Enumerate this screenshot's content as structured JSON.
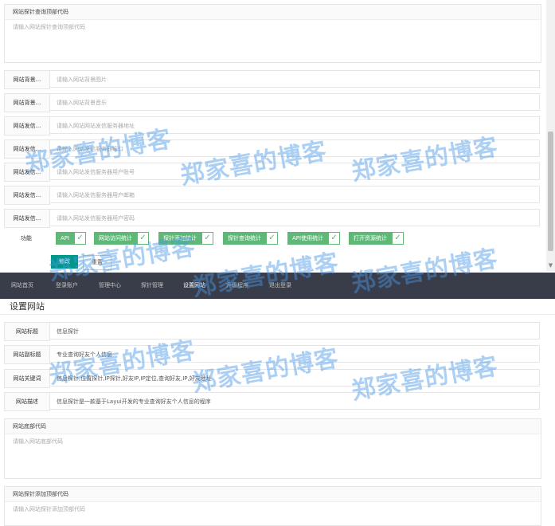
{
  "top_form": {
    "head_code_box": {
      "title": "网站探针查询顶部代码",
      "placeholder": "请输入网站探针查询顶部代码"
    },
    "rows": [
      {
        "label": "网站背景...",
        "placeholder": "请输入网站背景图片"
      },
      {
        "label": "网站背景...",
        "placeholder": "请输入网站背景音乐"
      },
      {
        "label": "网站发信...",
        "placeholder": "请输入网站网站发信服务器地址"
      },
      {
        "label": "网站发信...",
        "placeholder": "请输入网站发信服务器端口"
      },
      {
        "label": "网站发信...",
        "placeholder": "请输入网站发信服务器用户账号"
      },
      {
        "label": "网站发信...",
        "placeholder": "请输入网站发信服务器用户邮箱"
      },
      {
        "label": "网站发信...",
        "placeholder": "请输入网站发信服务器用户密码"
      }
    ],
    "features_label": "功能",
    "features": [
      "API",
      "网站访问统计",
      "探针添加统计",
      "探针查询统计",
      "API使用统计",
      "打开资源统计"
    ],
    "submit_label": "修改",
    "reset_label": "重置"
  },
  "nav": {
    "items": [
      "网站首页",
      "登录账户",
      "管理中心",
      "探针管理",
      "设置网站",
      "升级程序",
      "退出登录"
    ]
  },
  "settings": {
    "title": "设置网站",
    "rows": [
      {
        "label": "网站标题",
        "value": "信息探针"
      },
      {
        "label": "网站副标题",
        "value": "专业查询好友个人信息"
      },
      {
        "label": "网站关键词",
        "value": "信息探针,位置探针,IP探针,好友IP,IP定位,查询好友,IP,好友地址"
      },
      {
        "label": "网站描述",
        "value": "信息探针是一款基于Layui开发的专业查询好友个人信息的程序"
      }
    ],
    "footer_code_box": {
      "title": "网站底部代码",
      "placeholder": "请输入网站底部代码"
    },
    "add_head_code_box": {
      "title": "网站探针添加顶部代码",
      "placeholder": "请输入网站探针添加顶部代码"
    }
  },
  "watermark": "郑家喜的博客",
  "colors": {
    "accent": "#009688",
    "check_green": "#5fb878",
    "nav_bg": "#393d49",
    "watermark": "#4696e6"
  },
  "icons": {
    "checkbox": "check-icon",
    "scroll_down": "chevron-down-icon"
  }
}
